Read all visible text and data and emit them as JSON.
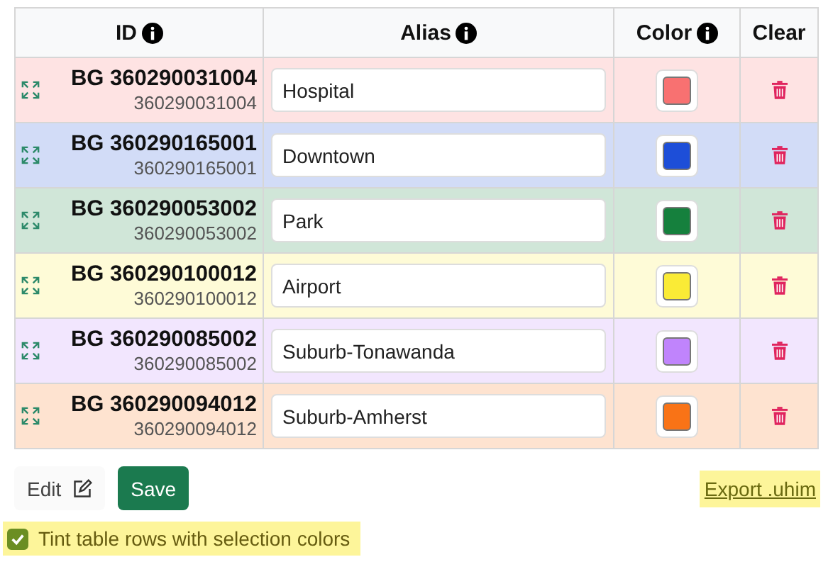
{
  "table": {
    "columns": [
      {
        "label": "ID",
        "info": true
      },
      {
        "label": "Alias",
        "info": true
      },
      {
        "label": "Color",
        "info": true
      },
      {
        "label": "Clear",
        "info": false
      }
    ],
    "rows": [
      {
        "id": "BG 360290031004",
        "geoid": "360290031004",
        "alias": "Hospital",
        "color": "#f87171"
      },
      {
        "id": "BG 360290165001",
        "geoid": "360290165001",
        "alias": "Downtown",
        "color": "#1d4ed8"
      },
      {
        "id": "BG 360290053002",
        "geoid": "360290053002",
        "alias": "Park",
        "color": "#15803d"
      },
      {
        "id": "BG 360290100012",
        "geoid": "360290100012",
        "alias": "Airport",
        "color": "#faeb36"
      },
      {
        "id": "BG 360290085002",
        "geoid": "360290085002",
        "alias": "Suburb-Tonawanda",
        "color": "#c084fc"
      },
      {
        "id": "BG 360290094012",
        "geoid": "360290094012",
        "alias": "Suburb-Amherst",
        "color": "#f97316"
      }
    ]
  },
  "buttons": {
    "edit": "Edit",
    "save": "Save"
  },
  "export_link": "Export .uhim",
  "tint_option": {
    "label": "Tint table rows with selection colors",
    "checked": true
  }
}
